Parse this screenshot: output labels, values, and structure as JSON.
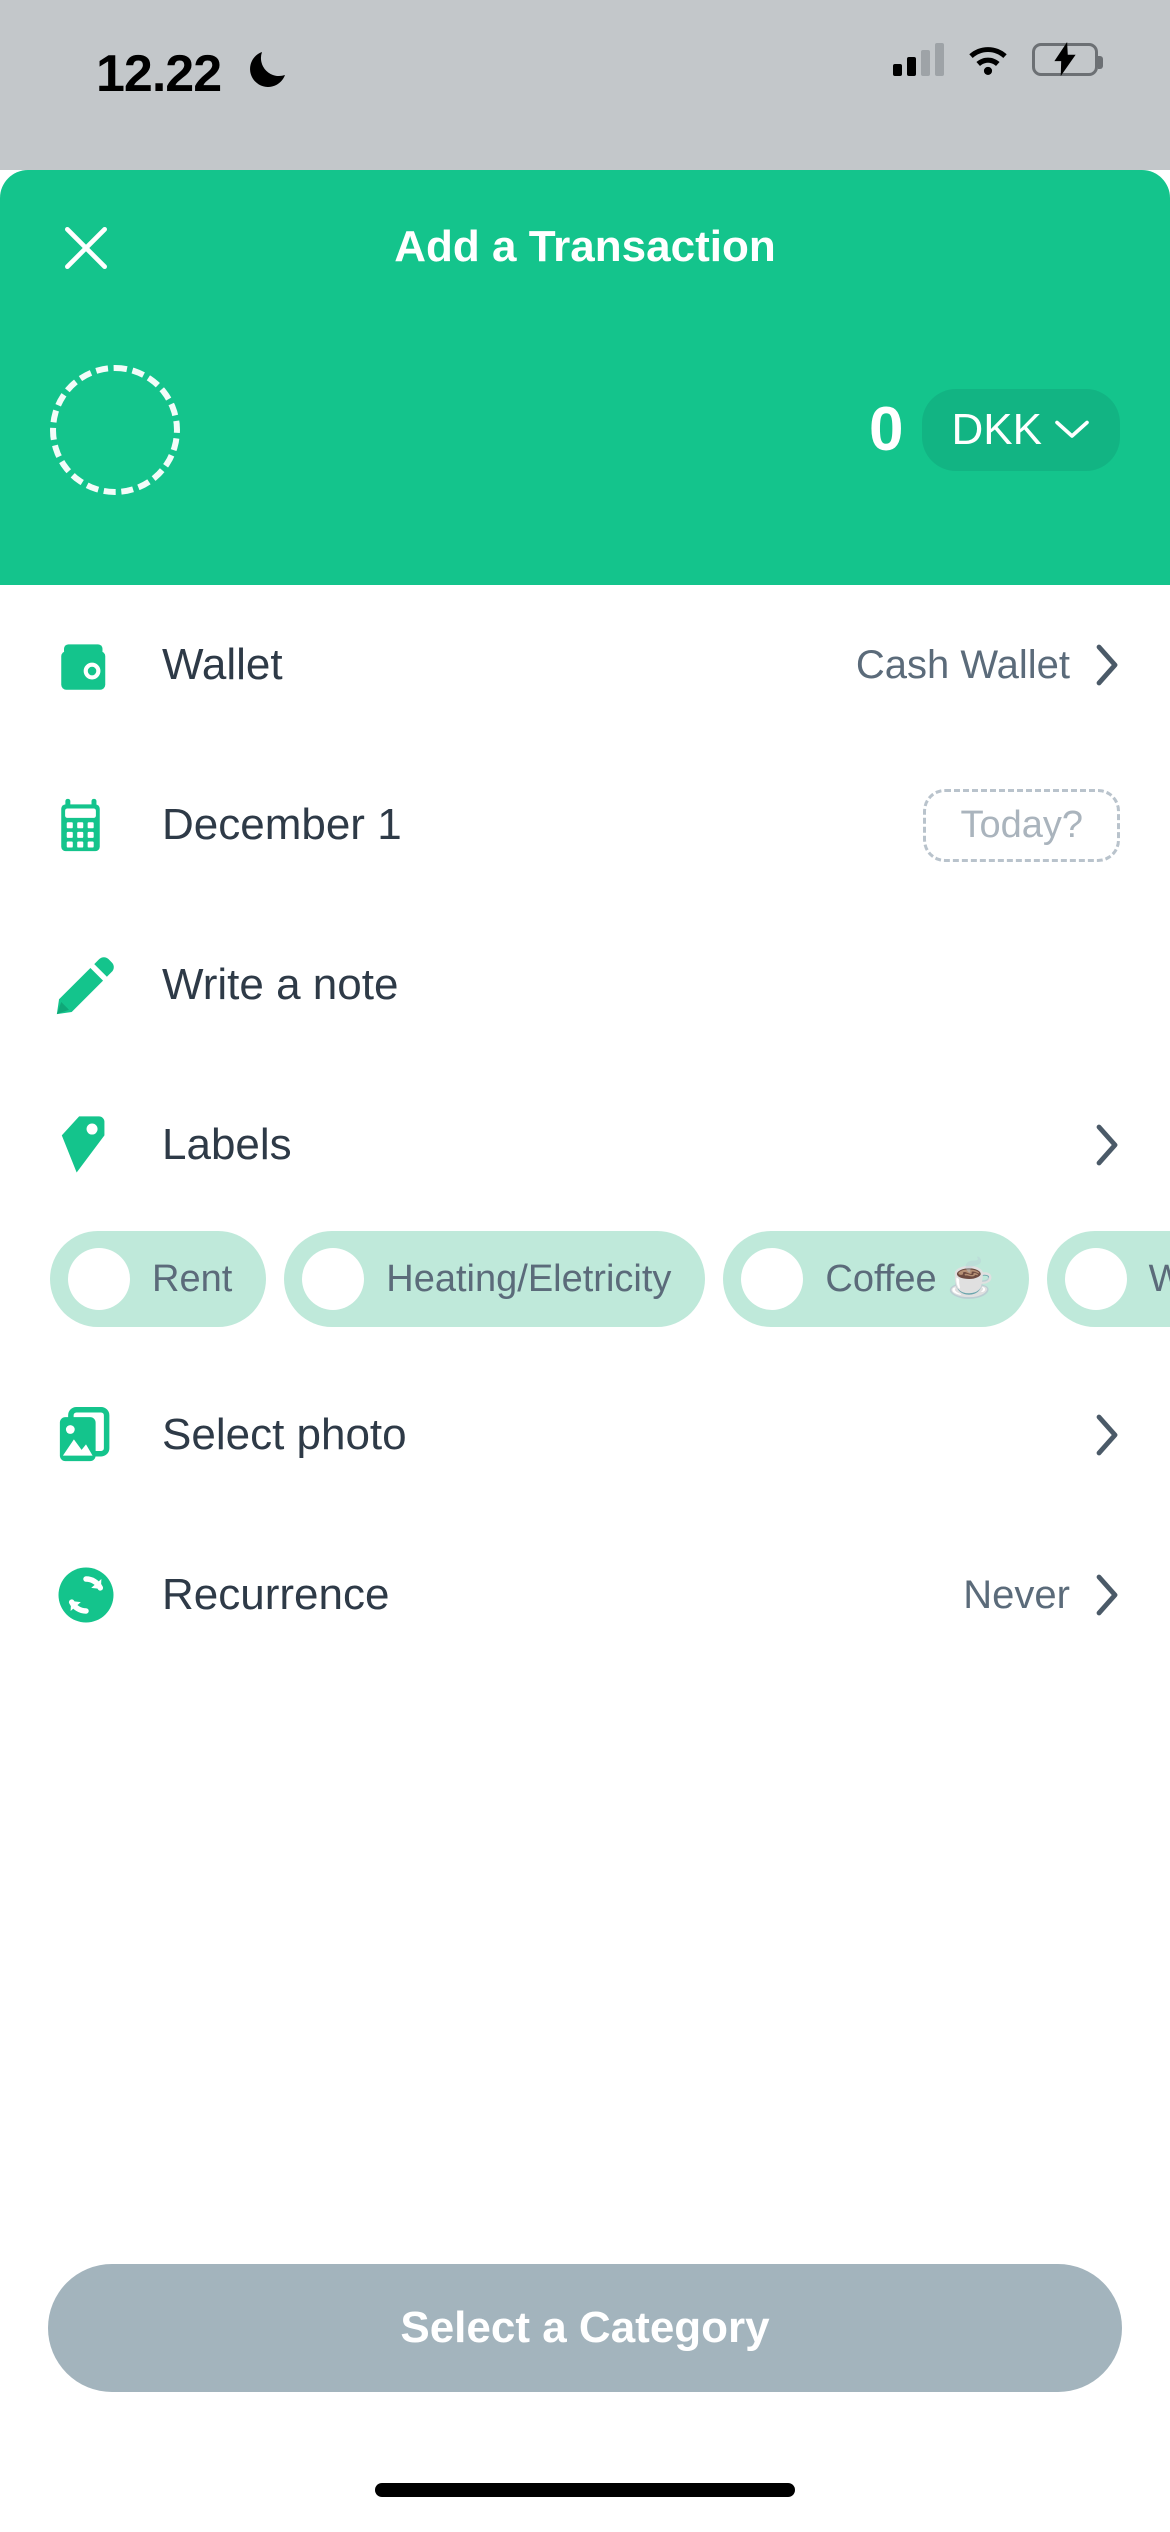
{
  "status_bar": {
    "time": "12.22",
    "dnd_icon": "crescent-moon-icon",
    "signal_icon": "cellular-signal-icon",
    "wifi_icon": "wifi-icon",
    "battery_icon": "battery-charging-icon"
  },
  "header": {
    "title": "Add a Transaction",
    "close_icon": "close-x-icon",
    "category_placeholder_icon": "dashed-circle-placeholder",
    "amount": "0",
    "currency": "DKK",
    "currency_chevron_icon": "chevron-down-icon",
    "accent_color": "#14c48c",
    "pill_color": "#12b483"
  },
  "rows": [
    {
      "icon": "wallet-icon",
      "label": "Wallet",
      "value": "Cash Wallet",
      "chevron": true
    },
    {
      "icon": "calendar-icon",
      "label": "December 1",
      "badge": "Today?",
      "chevron": false
    },
    {
      "icon": "pencil-icon",
      "label": "Write a note",
      "value": "",
      "chevron": false
    },
    {
      "icon": "tag-icon",
      "label": "Labels",
      "value": "",
      "chevron": true
    },
    {
      "icon": "photo-icon",
      "label": "Select photo",
      "value": "",
      "chevron": true
    },
    {
      "icon": "recurrence-icon",
      "label": "Recurrence",
      "value": "Never",
      "chevron": true
    }
  ],
  "labels": {
    "chip_bg": "#bfe9da",
    "chips": [
      {
        "text": "Rent"
      },
      {
        "text": "Heating/Eletricity"
      },
      {
        "text": "Coffee ☕"
      },
      {
        "text": "W"
      }
    ]
  },
  "footer": {
    "cta_label": "Select a Category",
    "cta_color": "#a3b4bd"
  }
}
